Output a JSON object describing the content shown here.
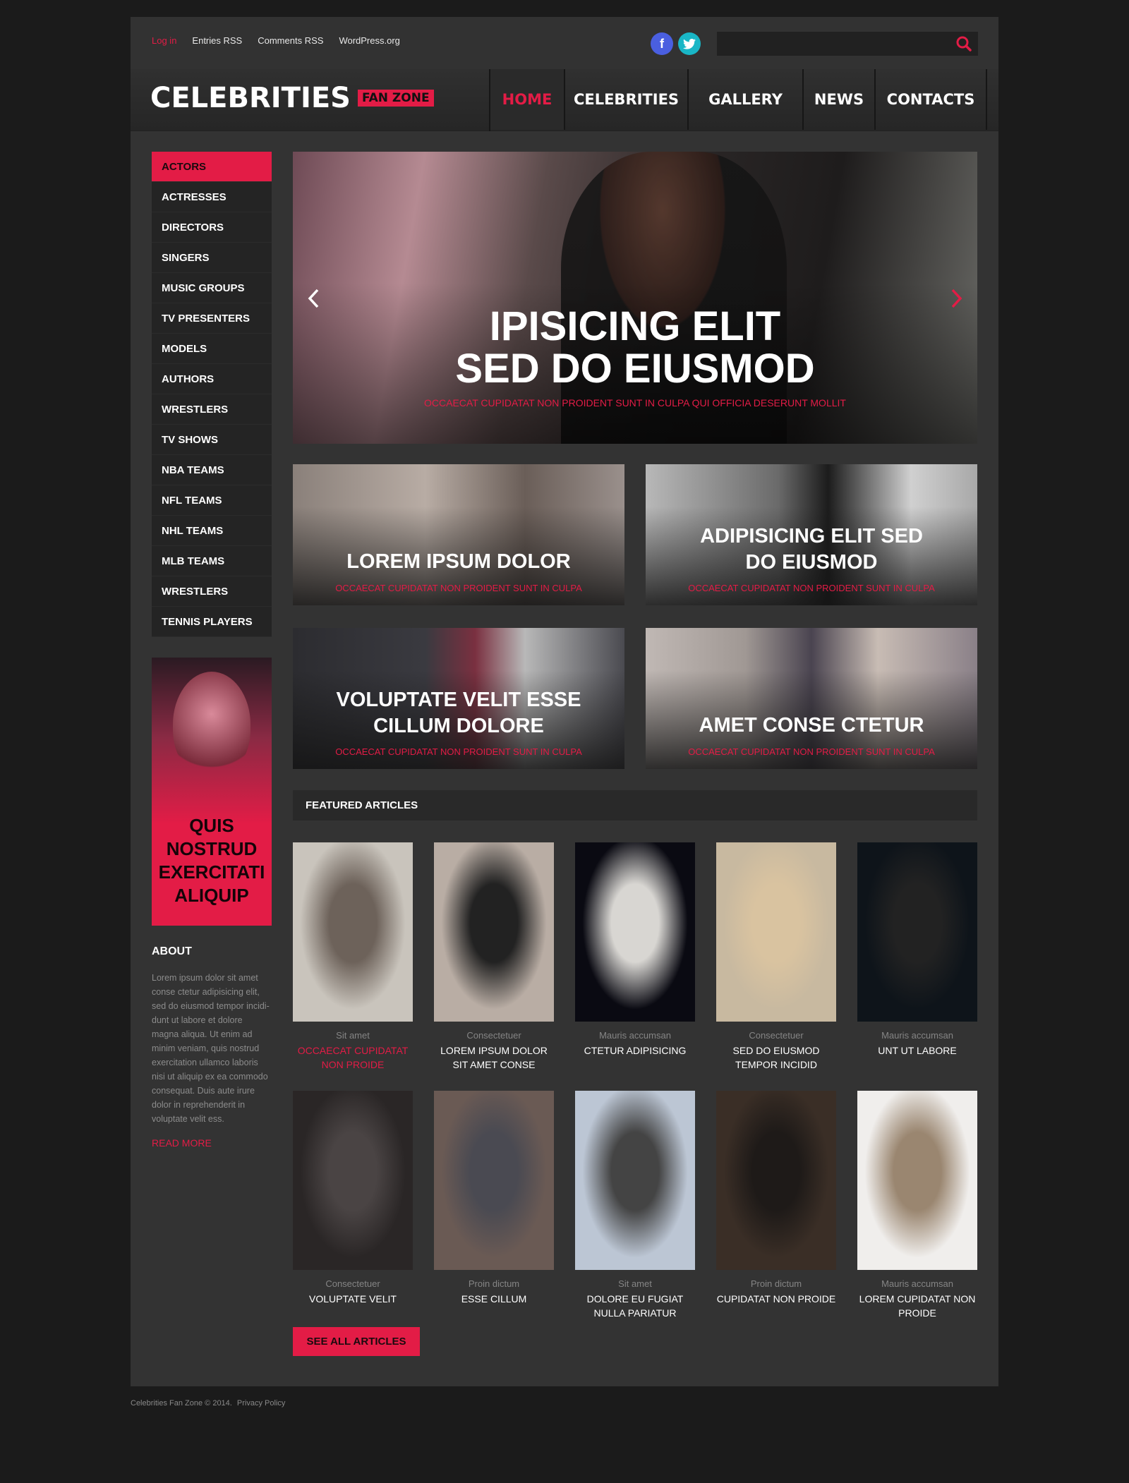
{
  "topbar": {
    "links": [
      "Log in",
      "Entries RSS",
      "Comments RSS",
      "WordPress.org"
    ],
    "active_link": "Log in",
    "social": [
      {
        "name": "facebook",
        "glyph": "f"
      },
      {
        "name": "twitter",
        "glyph": "t"
      }
    ],
    "search": {
      "value": "",
      "placeholder": ""
    }
  },
  "header": {
    "logo_main": "CELEBRITIES",
    "logo_tag": "FAN ZONE",
    "nav": [
      "HOME",
      "CELEBRITIES",
      "GALLERY",
      "NEWS",
      "CONTACTS"
    ],
    "active_nav": "HOME"
  },
  "sidebar": {
    "categories": [
      "ACTORS",
      "ACTRESSES",
      "DIRECTORS",
      "SINGERS",
      "MUSIC GROUPS",
      "TV PRESENTERS",
      "MODELS",
      "AUTHORS",
      "WRESTLERS",
      "TV SHOWS",
      "NBA TEAMS",
      "NFL TEAMS",
      "NHL TEAMS",
      "MLB TEAMS",
      "WRESTLERS",
      "TENNIS PLAYERS"
    ],
    "active_category": "ACTORS",
    "promo_text": "QUIS NOSTRUD EXERCITATI ALIQUIP",
    "about_heading": "ABOUT",
    "about_text": "Lorem ipsum dolor sit amet conse ctetur adipisicing elit, sed do eiusmod tempor incidi-dunt ut labore et dolore magna aliqua. Ut enim ad minim veniam, quis nostrud exercitation ullamco laboris nisi ut aliquip ex ea commodo consequat. Duis aute irure dolor in reprehenderit in voluptate velit ess.",
    "read_more": "READ MORE"
  },
  "slider": {
    "title_line1": "IPISICING ELIT",
    "title_line2": "SED DO EIUSMOD",
    "subtitle": "OCCAECAT CUPIDATAT NON PROIDENT SUNT IN CULPA QUI OFFICIA DESERUNT MOLLIT"
  },
  "tiles": [
    {
      "title_lines": [
        "LOREM IPSUM DOLOR"
      ],
      "subtitle": "OCCAECAT CUPIDATAT NON PROIDENT SUNT IN CULPA"
    },
    {
      "title_lines": [
        "ADIPISICING ELIT SED",
        "DO EIUSMOD"
      ],
      "subtitle": "OCCAECAT CUPIDATAT NON PROIDENT SUNT IN CULPA"
    },
    {
      "title_lines": [
        "VOLUPTATE VELIT ESSE",
        "CILLUM DOLORE"
      ],
      "subtitle": "OCCAECAT CUPIDATAT NON PROIDENT SUNT IN CULPA"
    },
    {
      "title_lines": [
        "AMET CONSE CTETUR"
      ],
      "subtitle": "OCCAECAT CUPIDATAT NON PROIDENT SUNT IN CULPA"
    }
  ],
  "featured": {
    "heading": "FEATURED ARTICLES",
    "articles": [
      {
        "meta": "Sit amet",
        "title": "OCCAECAT CUPIDATAT NON PROIDE",
        "highlight": true
      },
      {
        "meta": "Consectetuer",
        "title": "LOREM IPSUM DOLOR SIT AMET CONSE",
        "highlight": false
      },
      {
        "meta": "Mauris accumsan",
        "title": "CTETUR ADIPISICING",
        "highlight": false
      },
      {
        "meta": "Consectetuer",
        "title": "SED DO EIUSMOD TEMPOR INCIDID",
        "highlight": false
      },
      {
        "meta": "Mauris accumsan",
        "title": "UNT UT LABORE",
        "highlight": false
      },
      {
        "meta": "Consectetuer",
        "title": "VOLUPTATE VELIT",
        "highlight": false
      },
      {
        "meta": "Proin dictum",
        "title": "ESSE CILLUM",
        "highlight": false
      },
      {
        "meta": "Sit amet",
        "title": "DOLORE EU FUGIAT NULLA PARIATUR",
        "highlight": false
      },
      {
        "meta": "Proin dictum",
        "title": "CUPIDATAT NON PROIDE",
        "highlight": false
      },
      {
        "meta": "Mauris accumsan",
        "title": "LOREM  CUPIDATAT NON PROIDE",
        "highlight": false
      }
    ],
    "see_all": "SEE ALL ARTICLES"
  },
  "footer": {
    "copyright": "Celebrities Fan Zone © 2014.",
    "privacy": "Privacy Policy"
  },
  "colors": {
    "accent": "#e31c46",
    "page_bg": "#1b1b1b",
    "container_bg": "#333333",
    "sidebar_item_bg": "#242424",
    "facebook": "#4a5fe0",
    "twitter": "#19b6c6"
  }
}
